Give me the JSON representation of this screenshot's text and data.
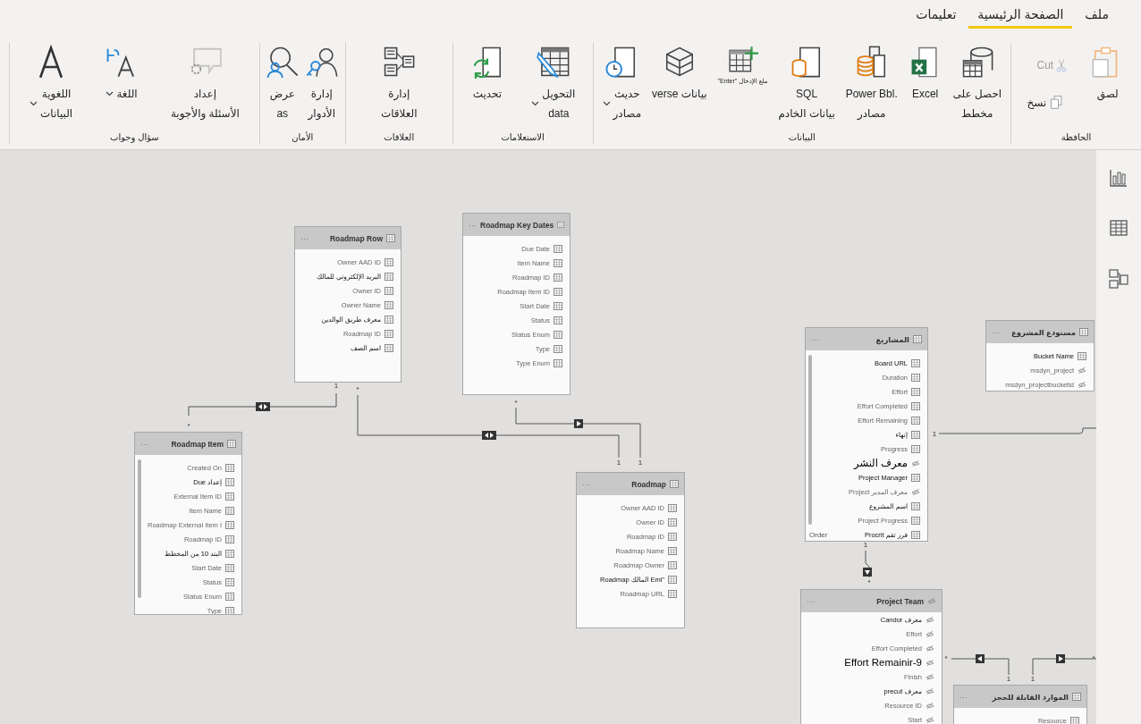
{
  "menu_tabs": [
    {
      "label": "ملف",
      "selected": false
    },
    {
      "label": "الصفحة الرئيسية",
      "selected": true
    },
    {
      "label": "تعليمات",
      "selected": false
    }
  ],
  "ribbon": {
    "groups": [
      {
        "label": "الحافظة",
        "buttons": [
          {
            "kind": "paste",
            "lines": [
              "لصق"
            ],
            "disabled": false,
            "dropdown": false
          },
          {
            "kind": "cut",
            "lines": [
              "Cut"
            ],
            "disabled": true,
            "dropdown": false
          },
          {
            "kind": "copy",
            "lines": [
              "نسخ"
            ],
            "disabled": false,
            "dropdown": false
          }
        ]
      },
      {
        "label": "البيانات",
        "buttons": [
          {
            "kind": "get-data",
            "lines": [
              "احصل على",
              "مخطط"
            ],
            "disabled": false,
            "dropdown": false
          },
          {
            "kind": "excel",
            "lines": [
              "Excel"
            ],
            "disabled": false,
            "dropdown": false
          },
          {
            "kind": "datasets",
            "lines": [
              ".Power Bbl",
              "مصادر"
            ],
            "disabled": false,
            "dropdown": false
          },
          {
            "kind": "sql",
            "lines": [
              "SQL",
              "بيانات الخادم"
            ],
            "disabled": false,
            "dropdown": false
          },
          {
            "kind": "enter-data",
            "lines": [
              "ملع الإدخال \"Enter\""
            ],
            "disabled": false,
            "dropdown": false
          },
          {
            "kind": "dataverse",
            "lines": [
              "بيانات verse"
            ],
            "disabled": false,
            "dropdown": false
          },
          {
            "kind": "recent",
            "lines": [
              "حديث",
              "مصادر"
            ],
            "disabled": false,
            "dropdown": true
          }
        ]
      },
      {
        "label": "الاستعلامات",
        "buttons": [
          {
            "kind": "transform",
            "lines": [
              "التحويل",
              "data"
            ],
            "disabled": false,
            "dropdown": true
          },
          {
            "kind": "refresh",
            "lines": [
              "تحديث"
            ],
            "disabled": false,
            "dropdown": false
          }
        ]
      },
      {
        "label": "العلاقات",
        "buttons": [
          {
            "kind": "relationships",
            "lines": [
              "إدارة",
              "العلاقات"
            ],
            "disabled": false,
            "dropdown": false
          }
        ]
      },
      {
        "label": "الأمان",
        "buttons": [
          {
            "kind": "roles",
            "lines": [
              "إدارة",
              "الأدوار"
            ],
            "disabled": false,
            "dropdown": false
          },
          {
            "kind": "view-as",
            "lines": [
              "عرض",
              "as"
            ],
            "disabled": false,
            "dropdown": false
          }
        ]
      },
      {
        "label": "سؤال وجواب",
        "buttons": [
          {
            "kind": "qa-setup",
            "lines": [
              "إعداد",
              "الأسئلة والأجوبة"
            ],
            "disabled": false,
            "dropdown": false
          },
          {
            "kind": "language",
            "lines": [
              "اللغة"
            ],
            "disabled": false,
            "dropdown": true
          },
          {
            "kind": "linguistic",
            "lines": [
              "اللغوية",
              "البيانات"
            ],
            "disabled": false,
            "dropdown": true
          }
        ]
      }
    ]
  },
  "canvas": {
    "tables": [
      {
        "title": "مستودع المشروع",
        "kind": "table",
        "more": "···",
        "scrollable": false,
        "fields": [
          {
            "name": "Bucket Name",
            "kind": "column",
            "emphasized": true,
            "large": false
          },
          {
            "name": "msdyn_project",
            "kind": "hidden",
            "emphasized": false,
            "large": false
          },
          {
            "name": "msdyn_projectbucketid",
            "kind": "hidden",
            "emphasized": false,
            "large": false
          }
        ]
      },
      {
        "title": "المشاريع",
        "kind": "table",
        "more": "···",
        "scrollable": true,
        "fields": [
          {
            "name": "Board URL",
            "kind": "column",
            "emphasized": true,
            "large": false
          },
          {
            "name": "Duration",
            "kind": "column",
            "emphasized": false,
            "large": false
          },
          {
            "name": "Effort",
            "kind": "column",
            "emphasized": false,
            "large": false
          },
          {
            "name": "Effort Completed",
            "kind": "column",
            "emphasized": false,
            "large": false
          },
          {
            "name": "Effort Remaining",
            "kind": "column",
            "emphasized": false,
            "large": false
          },
          {
            "name": "إنهاء",
            "kind": "column",
            "emphasized": true,
            "large": false
          },
          {
            "name": "Progress",
            "kind": "column",
            "emphasized": false,
            "large": false
          },
          {
            "name": "معرف النشر",
            "kind": "hidden",
            "emphasized": true,
            "large": true
          },
          {
            "name": "Project Manager",
            "kind": "column",
            "emphasized": true,
            "large": false
          },
          {
            "name": "Project معرف المدير",
            "kind": "hidden",
            "emphasized": false,
            "large": false
          },
          {
            "name": "اسم المشروع",
            "kind": "column",
            "emphasized": true,
            "large": false
          },
          {
            "name": "Project Progress",
            "kind": "column",
            "emphasized": false,
            "large": false
          },
          {
            "name": "فرز تقم Procrit",
            "kind": "column",
            "emphasized": true,
            "large": false,
            "extra": "Order"
          }
        ]
      },
      {
        "title": "الموارد القابلة للحجز",
        "kind": "table",
        "more": "···",
        "scrollable": false,
        "fields": [
          {
            "name": "Resource",
            "kind": "column",
            "emphasized": false,
            "large": false
          }
        ]
      },
      {
        "title": "Project Team",
        "kind": "hidden",
        "more": "···",
        "scrollable": false,
        "fields": [
          {
            "name": "معرف Candor",
            "kind": "hidden",
            "emphasized": true,
            "large": false
          },
          {
            "name": "Effort",
            "kind": "hidden",
            "emphasized": false,
            "large": false
          },
          {
            "name": "Effort Completed",
            "kind": "hidden",
            "emphasized": false,
            "large": false
          },
          {
            "name": "Effort Remainir-9",
            "kind": "hidden",
            "emphasized": true,
            "large": true
          },
          {
            "name": "Finish",
            "kind": "hidden",
            "emphasized": false,
            "large": false
          },
          {
            "name": "معرف precut",
            "kind": "hidden",
            "emphasized": true,
            "large": false
          },
          {
            "name": "Resource ID",
            "kind": "hidden",
            "emphasized": false,
            "large": false
          },
          {
            "name": "Start",
            "kind": "hidden",
            "emphasized": false,
            "large": false
          }
        ]
      },
      {
        "title": "Roadmap",
        "kind": "table",
        "more": "···",
        "scrollable": false,
        "fields": [
          {
            "name": "Owner AAD ID",
            "kind": "column",
            "emphasized": false,
            "large": false
          },
          {
            "name": "Owner ID",
            "kind": "column",
            "emphasized": false,
            "large": false
          },
          {
            "name": "Roadmap ID",
            "kind": "column",
            "emphasized": false,
            "large": false
          },
          {
            "name": "Roadmap Name",
            "kind": "column",
            "emphasized": false,
            "large": false
          },
          {
            "name": "Roadmap Owner",
            "kind": "column",
            "emphasized": false,
            "large": false
          },
          {
            "name": "Roadmap المالك Emi\"",
            "kind": "column",
            "emphasized": true,
            "large": false
          },
          {
            "name": "Roadmap URL",
            "kind": "column",
            "emphasized": false,
            "large": false
          }
        ]
      },
      {
        "title": "Roadmap Key Dates",
        "kind": "table",
        "more": "···",
        "scrollable": false,
        "fields": [
          {
            "name": "Due Date",
            "kind": "column",
            "emphasized": false,
            "large": false
          },
          {
            "name": "Item Name",
            "kind": "column",
            "emphasized": false,
            "large": false
          },
          {
            "name": "Roadmap ID",
            "kind": "column",
            "emphasized": false,
            "large": false
          },
          {
            "name": "Roadmap Item ID",
            "kind": "column",
            "emphasized": false,
            "large": false
          },
          {
            "name": "Start Date",
            "kind": "column",
            "emphasized": false,
            "large": false
          },
          {
            "name": "Status",
            "kind": "column",
            "emphasized": false,
            "large": false
          },
          {
            "name": "Status Enum",
            "kind": "column",
            "emphasized": false,
            "large": false
          },
          {
            "name": "Type",
            "kind": "column",
            "emphasized": false,
            "large": false
          },
          {
            "name": "Type Enum",
            "kind": "column",
            "emphasized": false,
            "large": false
          }
        ]
      },
      {
        "title": "Roadmap Row",
        "kind": "table",
        "more": "···",
        "scrollable": false,
        "fields": [
          {
            "name": "Owner AAD ID",
            "kind": "column",
            "emphasized": false,
            "large": false
          },
          {
            "name": "البريد الإلكتروني للمالك",
            "kind": "column",
            "emphasized": true,
            "large": false
          },
          {
            "name": "Owner ID",
            "kind": "column",
            "emphasized": false,
            "large": false
          },
          {
            "name": "Owner Name",
            "kind": "column",
            "emphasized": false,
            "large": false
          },
          {
            "name": "معرف طريق الوالدين",
            "kind": "column",
            "emphasized": true,
            "large": false
          },
          {
            "name": "Roadmap ID",
            "kind": "column",
            "emphasized": false,
            "large": false
          },
          {
            "name": "اسم الصف",
            "kind": "column",
            "emphasized": true,
            "large": false
          }
        ]
      },
      {
        "title": "Roadmap Item",
        "kind": "table",
        "more": "···",
        "scrollable": true,
        "fields": [
          {
            "name": "Created On",
            "kind": "column",
            "emphasized": false,
            "large": false
          },
          {
            "name": "Due إعداد",
            "kind": "column",
            "emphasized": true,
            "large": false
          },
          {
            "name": "External Item ID",
            "kind": "column",
            "emphasized": false,
            "large": false
          },
          {
            "name": "Item Name",
            "kind": "column",
            "emphasized": false,
            "large": false
          },
          {
            "name": "Roadmap External Item I",
            "kind": "column",
            "emphasized": false,
            "large": false
          },
          {
            "name": "Roadmap ID",
            "kind": "column",
            "emphasized": false,
            "large": false
          },
          {
            "name": "البند 10 من المخطط",
            "kind": "column",
            "emphasized": true,
            "large": false
          },
          {
            "name": "Start Date",
            "kind": "column",
            "emphasized": false,
            "large": false
          },
          {
            "name": "Status",
            "kind": "column",
            "emphasized": false,
            "large": false
          },
          {
            "name": "Status Enum",
            "kind": "column",
            "emphasized": false,
            "large": false
          },
          {
            "name": "Type",
            "kind": "column",
            "emphasized": false,
            "large": false
          }
        ]
      }
    ],
    "relationships": [
      {
        "from_label": "1",
        "kind": "none"
      },
      {
        "from_label": "*",
        "to_label": "1",
        "kind": "right"
      },
      {
        "from_label": "*",
        "to_label": "1",
        "kind": "left"
      },
      {
        "from_label": "1",
        "to_label": "*",
        "kind": "down"
      },
      {
        "from_label": "*",
        "to_label": "1",
        "kind": "right"
      },
      {
        "from_label": "*",
        "to_label": "1",
        "kind": "both"
      },
      {
        "from_label": "1",
        "to_label": "*",
        "kind": "both"
      }
    ]
  }
}
